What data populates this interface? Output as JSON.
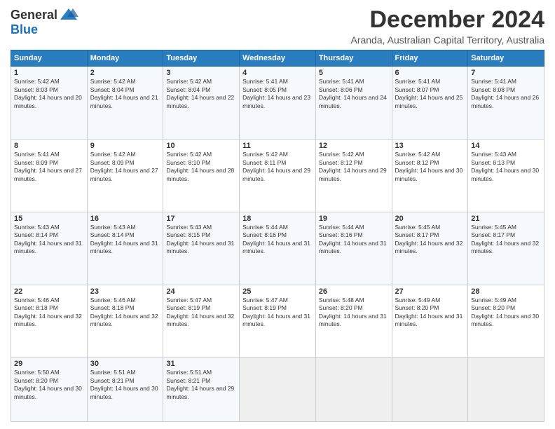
{
  "logo": {
    "general": "General",
    "blue": "Blue"
  },
  "header": {
    "month": "December 2024",
    "subtitle": "Aranda, Australian Capital Territory, Australia"
  },
  "weekdays": [
    "Sunday",
    "Monday",
    "Tuesday",
    "Wednesday",
    "Thursday",
    "Friday",
    "Saturday"
  ],
  "weeks": [
    [
      {
        "day": "1",
        "sunrise": "Sunrise: 5:42 AM",
        "sunset": "Sunset: 8:03 PM",
        "daylight": "Daylight: 14 hours and 20 minutes."
      },
      {
        "day": "2",
        "sunrise": "Sunrise: 5:42 AM",
        "sunset": "Sunset: 8:04 PM",
        "daylight": "Daylight: 14 hours and 21 minutes."
      },
      {
        "day": "3",
        "sunrise": "Sunrise: 5:42 AM",
        "sunset": "Sunset: 8:04 PM",
        "daylight": "Daylight: 14 hours and 22 minutes."
      },
      {
        "day": "4",
        "sunrise": "Sunrise: 5:41 AM",
        "sunset": "Sunset: 8:05 PM",
        "daylight": "Daylight: 14 hours and 23 minutes."
      },
      {
        "day": "5",
        "sunrise": "Sunrise: 5:41 AM",
        "sunset": "Sunset: 8:06 PM",
        "daylight": "Daylight: 14 hours and 24 minutes."
      },
      {
        "day": "6",
        "sunrise": "Sunrise: 5:41 AM",
        "sunset": "Sunset: 8:07 PM",
        "daylight": "Daylight: 14 hours and 25 minutes."
      },
      {
        "day": "7",
        "sunrise": "Sunrise: 5:41 AM",
        "sunset": "Sunset: 8:08 PM",
        "daylight": "Daylight: 14 hours and 26 minutes."
      }
    ],
    [
      {
        "day": "8",
        "sunrise": "Sunrise: 5:41 AM",
        "sunset": "Sunset: 8:09 PM",
        "daylight": "Daylight: 14 hours and 27 minutes."
      },
      {
        "day": "9",
        "sunrise": "Sunrise: 5:42 AM",
        "sunset": "Sunset: 8:09 PM",
        "daylight": "Daylight: 14 hours and 27 minutes."
      },
      {
        "day": "10",
        "sunrise": "Sunrise: 5:42 AM",
        "sunset": "Sunset: 8:10 PM",
        "daylight": "Daylight: 14 hours and 28 minutes."
      },
      {
        "day": "11",
        "sunrise": "Sunrise: 5:42 AM",
        "sunset": "Sunset: 8:11 PM",
        "daylight": "Daylight: 14 hours and 29 minutes."
      },
      {
        "day": "12",
        "sunrise": "Sunrise: 5:42 AM",
        "sunset": "Sunset: 8:12 PM",
        "daylight": "Daylight: 14 hours and 29 minutes."
      },
      {
        "day": "13",
        "sunrise": "Sunrise: 5:42 AM",
        "sunset": "Sunset: 8:12 PM",
        "daylight": "Daylight: 14 hours and 30 minutes."
      },
      {
        "day": "14",
        "sunrise": "Sunrise: 5:43 AM",
        "sunset": "Sunset: 8:13 PM",
        "daylight": "Daylight: 14 hours and 30 minutes."
      }
    ],
    [
      {
        "day": "15",
        "sunrise": "Sunrise: 5:43 AM",
        "sunset": "Sunset: 8:14 PM",
        "daylight": "Daylight: 14 hours and 31 minutes."
      },
      {
        "day": "16",
        "sunrise": "Sunrise: 5:43 AM",
        "sunset": "Sunset: 8:14 PM",
        "daylight": "Daylight: 14 hours and 31 minutes."
      },
      {
        "day": "17",
        "sunrise": "Sunrise: 5:43 AM",
        "sunset": "Sunset: 8:15 PM",
        "daylight": "Daylight: 14 hours and 31 minutes."
      },
      {
        "day": "18",
        "sunrise": "Sunrise: 5:44 AM",
        "sunset": "Sunset: 8:16 PM",
        "daylight": "Daylight: 14 hours and 31 minutes."
      },
      {
        "day": "19",
        "sunrise": "Sunrise: 5:44 AM",
        "sunset": "Sunset: 8:16 PM",
        "daylight": "Daylight: 14 hours and 31 minutes."
      },
      {
        "day": "20",
        "sunrise": "Sunrise: 5:45 AM",
        "sunset": "Sunset: 8:17 PM",
        "daylight": "Daylight: 14 hours and 32 minutes."
      },
      {
        "day": "21",
        "sunrise": "Sunrise: 5:45 AM",
        "sunset": "Sunset: 8:17 PM",
        "daylight": "Daylight: 14 hours and 32 minutes."
      }
    ],
    [
      {
        "day": "22",
        "sunrise": "Sunrise: 5:46 AM",
        "sunset": "Sunset: 8:18 PM",
        "daylight": "Daylight: 14 hours and 32 minutes."
      },
      {
        "day": "23",
        "sunrise": "Sunrise: 5:46 AM",
        "sunset": "Sunset: 8:18 PM",
        "daylight": "Daylight: 14 hours and 32 minutes."
      },
      {
        "day": "24",
        "sunrise": "Sunrise: 5:47 AM",
        "sunset": "Sunset: 8:19 PM",
        "daylight": "Daylight: 14 hours and 32 minutes."
      },
      {
        "day": "25",
        "sunrise": "Sunrise: 5:47 AM",
        "sunset": "Sunset: 8:19 PM",
        "daylight": "Daylight: 14 hours and 31 minutes."
      },
      {
        "day": "26",
        "sunrise": "Sunrise: 5:48 AM",
        "sunset": "Sunset: 8:20 PM",
        "daylight": "Daylight: 14 hours and 31 minutes."
      },
      {
        "day": "27",
        "sunrise": "Sunrise: 5:49 AM",
        "sunset": "Sunset: 8:20 PM",
        "daylight": "Daylight: 14 hours and 31 minutes."
      },
      {
        "day": "28",
        "sunrise": "Sunrise: 5:49 AM",
        "sunset": "Sunset: 8:20 PM",
        "daylight": "Daylight: 14 hours and 30 minutes."
      }
    ],
    [
      {
        "day": "29",
        "sunrise": "Sunrise: 5:50 AM",
        "sunset": "Sunset: 8:20 PM",
        "daylight": "Daylight: 14 hours and 30 minutes."
      },
      {
        "day": "30",
        "sunrise": "Sunrise: 5:51 AM",
        "sunset": "Sunset: 8:21 PM",
        "daylight": "Daylight: 14 hours and 30 minutes."
      },
      {
        "day": "31",
        "sunrise": "Sunrise: 5:51 AM",
        "sunset": "Sunset: 8:21 PM",
        "daylight": "Daylight: 14 hours and 29 minutes."
      },
      null,
      null,
      null,
      null
    ]
  ]
}
